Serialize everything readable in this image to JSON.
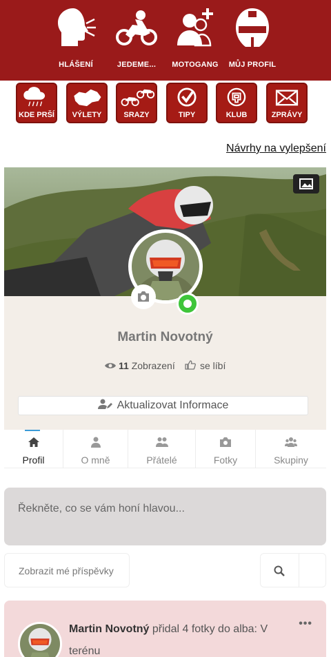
{
  "top_nav": [
    {
      "label": "HLÁŠENÍ",
      "icon": "shouting-head-icon"
    },
    {
      "label": "JEDEME...",
      "icon": "motorcycle-icon"
    },
    {
      "label": "MOTOGANG",
      "icon": "add-group-icon"
    },
    {
      "label": "MŮJ PROFIL",
      "icon": "helmet-icon"
    }
  ],
  "quick_buttons": [
    {
      "label": "KDE PRŠÍ",
      "icon": "rain-cloud-icon"
    },
    {
      "label": "VÝLETY",
      "icon": "map-icon"
    },
    {
      "label": "SRAZY",
      "icon": "motorcycles-icon"
    },
    {
      "label": "TIPY",
      "icon": "checkmark-icon"
    },
    {
      "label": "KLUB",
      "icon": "club-badge-icon"
    },
    {
      "label": "ZPRÁVY",
      "icon": "envelope-icon"
    }
  ],
  "suggest_link": "Návrhy na vylepšení",
  "profile": {
    "name": "Martin Novotný",
    "views_count": "11",
    "views_label": "Zobrazení",
    "likes_label": "se líbí",
    "update_button": "Aktualizovat Informace",
    "online_status_color": "#3fc53a"
  },
  "tabs": [
    {
      "label": "Profil",
      "icon": "home-icon",
      "active": true
    },
    {
      "label": "O mně",
      "icon": "user-icon",
      "active": false
    },
    {
      "label": "Přátelé",
      "icon": "friends-icon",
      "active": false
    },
    {
      "label": "Fotky",
      "icon": "camera-icon",
      "active": false
    },
    {
      "label": "Skupiny",
      "icon": "groups-icon",
      "active": false
    }
  ],
  "composer_placeholder": "Řekněte, co se vám honí hlavou...",
  "filter_label": "Zobrazit mé příspěvky",
  "post": {
    "author": "Martin Novotný",
    "action": " přidal 4 fotky do alba: V terénu",
    "more": "•••"
  },
  "colors": {
    "brand_red": "#9a1a1a",
    "button_red": "#a51b15",
    "accent_blue": "#3b9bd7"
  }
}
